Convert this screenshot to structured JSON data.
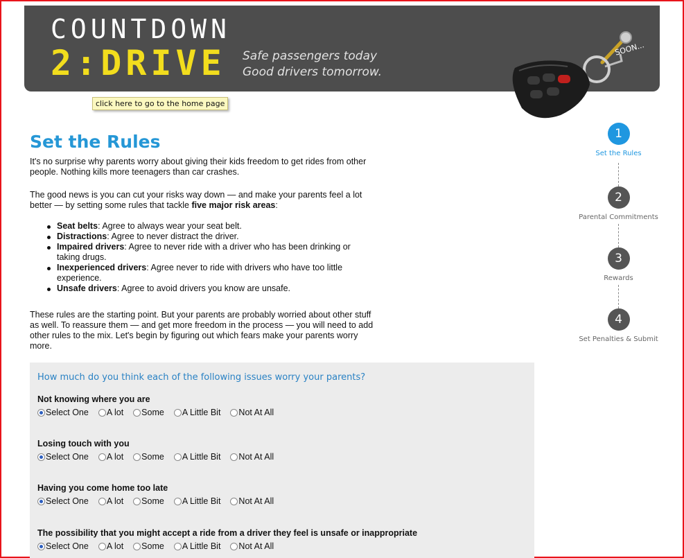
{
  "header": {
    "logo_line1": "COUNTDOWN",
    "logo_line2": "2:DRIVE",
    "tagline_line1": "Safe passengers today",
    "tagline_line2": "Good drivers tomorrow.",
    "soon_text": "SOON...",
    "home_tooltip": "click here to go to the home page"
  },
  "colors": {
    "accent": "#1f97e0",
    "header_bg": "#4d4d4d",
    "logo_yellow": "#f2dd1d",
    "frame": "#e8141b"
  },
  "main": {
    "title": "Set the Rules",
    "intro": "It's no surprise why parents worry about giving their kids freedom to get rides from other people. Nothing kills more teenagers than car crashes.",
    "good_news_prefix": "The good news is you can cut your risks way down — and make your parents feel a lot better — by setting some rules that tackle ",
    "good_news_bold": "five major risk areas",
    "good_news_suffix": ":",
    "rules": [
      {
        "term": "Seat belts",
        "desc": ": Agree to always wear your seat belt."
      },
      {
        "term": "Distractions",
        "desc": ": Agree to never distract the driver."
      },
      {
        "term": "Impaired drivers",
        "desc": ": Agree to never ride with a driver who has been drinking or taking drugs."
      },
      {
        "term": "Inexperienced drivers",
        "desc": ": Agree never to ride with drivers who have too little experience."
      },
      {
        "term": "Unsafe drivers",
        "desc": ": Agree to avoid drivers you know are unsafe."
      }
    ],
    "closing": "These rules are the starting point. But your parents are probably worried about other stuff as well. To reassure them — and get more freedom in the process — you will need to add other rules to the mix. Let's begin by figuring out which fears make your parents worry more."
  },
  "steps": [
    {
      "number": "1",
      "label": "Set the Rules",
      "active": true
    },
    {
      "number": "2",
      "label": "Parental Commitments",
      "active": false
    },
    {
      "number": "3",
      "label": "Rewards",
      "active": false
    },
    {
      "number": "4",
      "label": "Set Penalties & Submit",
      "active": false
    }
  ],
  "survey": {
    "question": "How much do you think each of the following issues worry your parents?",
    "options": [
      "Select One",
      "A lot",
      "Some",
      "A Little Bit",
      "Not At All"
    ],
    "items": [
      {
        "label": "Not knowing where you are",
        "selected": "Select One"
      },
      {
        "label": "Losing touch with you",
        "selected": "Select One"
      },
      {
        "label": "Having you come home too late",
        "selected": "Select One"
      },
      {
        "label": "The possibility that you might accept a ride from a driver they feel is unsafe or inappropriate",
        "selected": "Select One"
      }
    ]
  }
}
